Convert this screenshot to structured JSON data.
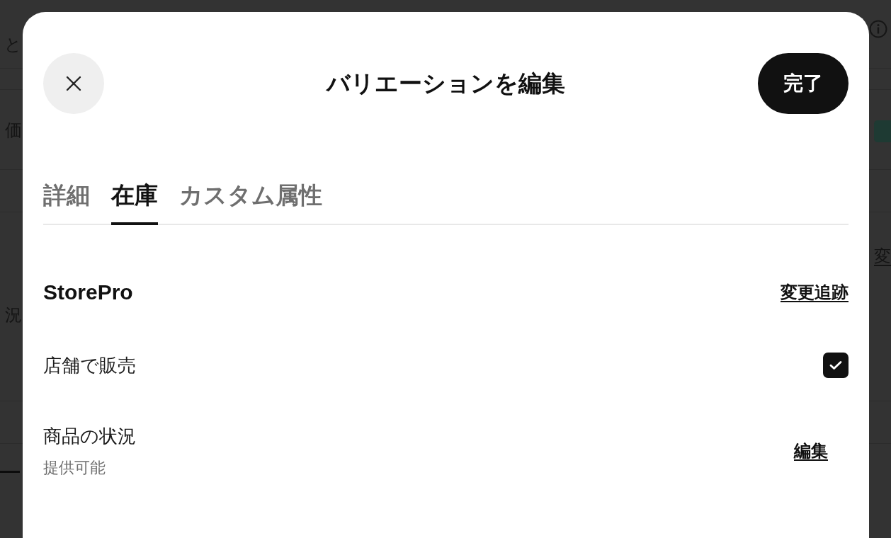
{
  "background": {
    "left_texts": [
      "と",
      "価",
      "況"
    ],
    "right_texts": [
      {
        "kind": "link",
        "text": "変"
      }
    ]
  },
  "dialog": {
    "title": "バリエーションを編集",
    "done_button": "完了",
    "tabs": [
      {
        "label": "詳細",
        "selected": false
      },
      {
        "label": "在庫",
        "selected": true
      },
      {
        "label": "カスタム属性",
        "selected": false
      }
    ],
    "section": {
      "title": "StorePro",
      "link": "変更追跡",
      "rows": [
        {
          "kind": "checkbox",
          "label": "店舗で販売",
          "checked": true
        },
        {
          "kind": "status",
          "label": "商品の状況",
          "value": "提供可能",
          "action": "編集"
        }
      ]
    }
  }
}
